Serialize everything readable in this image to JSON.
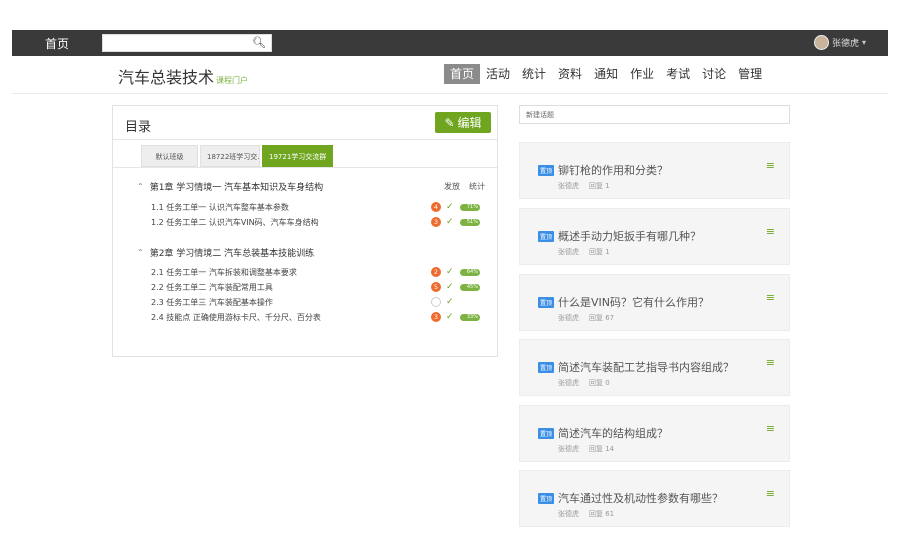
{
  "topbar": {
    "home": "首页",
    "user": "张德虎",
    "caret": "▾"
  },
  "course": {
    "title": "汽车总装技术",
    "portal": "课程门户"
  },
  "nav": [
    "首页",
    "活动",
    "统计",
    "资料",
    "通知",
    "作业",
    "考试",
    "讨论",
    "管理"
  ],
  "toc": {
    "title": "目录",
    "edit": "编辑",
    "tabs": [
      "默认班级",
      "18722班学习交...",
      "19721学习交流群"
    ],
    "col_publish": "发放",
    "col_stats": "统计",
    "chapters": [
      {
        "title": "第1章 学习情境一 汽车基本知识及车身结构",
        "lessons": [
          {
            "num": "1.1",
            "title": "任务工单一 认识汽车整车基本参数",
            "badge": "4",
            "pct": "71%"
          },
          {
            "num": "1.2",
            "title": "任务工单二 认识汽车VIN码、汽车车身结构",
            "badge": "3",
            "pct": "51%"
          }
        ]
      },
      {
        "title": "第2章 学习情境二 汽车总装基本技能训练",
        "lessons": [
          {
            "num": "2.1",
            "title": "任务工单一 汽车拆装和调整基本要求",
            "badge": "2",
            "pct": "64%"
          },
          {
            "num": "2.2",
            "title": "任务工单二 汽车装配常用工具",
            "badge": "5",
            "pct": "45%"
          },
          {
            "num": "2.3",
            "title": "任务工单三 汽车装配基本操作",
            "badge": "",
            "pct": ""
          },
          {
            "num": "2.4",
            "title": "技能点 正确使用游标卡尺、千分尺、百分表",
            "badge": "3",
            "pct": "33%"
          }
        ]
      }
    ]
  },
  "topics": {
    "placeholder": "新建话题",
    "tag": "置顶",
    "author": "张德虎",
    "items": [
      {
        "title": "铆钉枪的作用和分类？",
        "reply": "回复 1"
      },
      {
        "title": "概述手动力矩扳手有哪几种？",
        "reply": "回复 1"
      },
      {
        "title": "什么是VIN码？它有什么作用？",
        "reply": "回复 67"
      },
      {
        "title": "简述汽车装配工艺指导书内容组成？",
        "reply": "回复 0"
      },
      {
        "title": "简述汽车的结构组成？",
        "reply": "回复 14"
      },
      {
        "title": "汽车通过性及机动性参数有哪些？",
        "reply": "回复 61"
      }
    ]
  },
  "colors": {
    "accent": "#6fa51f",
    "topbar": "#3a3a3a",
    "badge": "#ee6b2d",
    "tag": "#3a8ee6"
  }
}
